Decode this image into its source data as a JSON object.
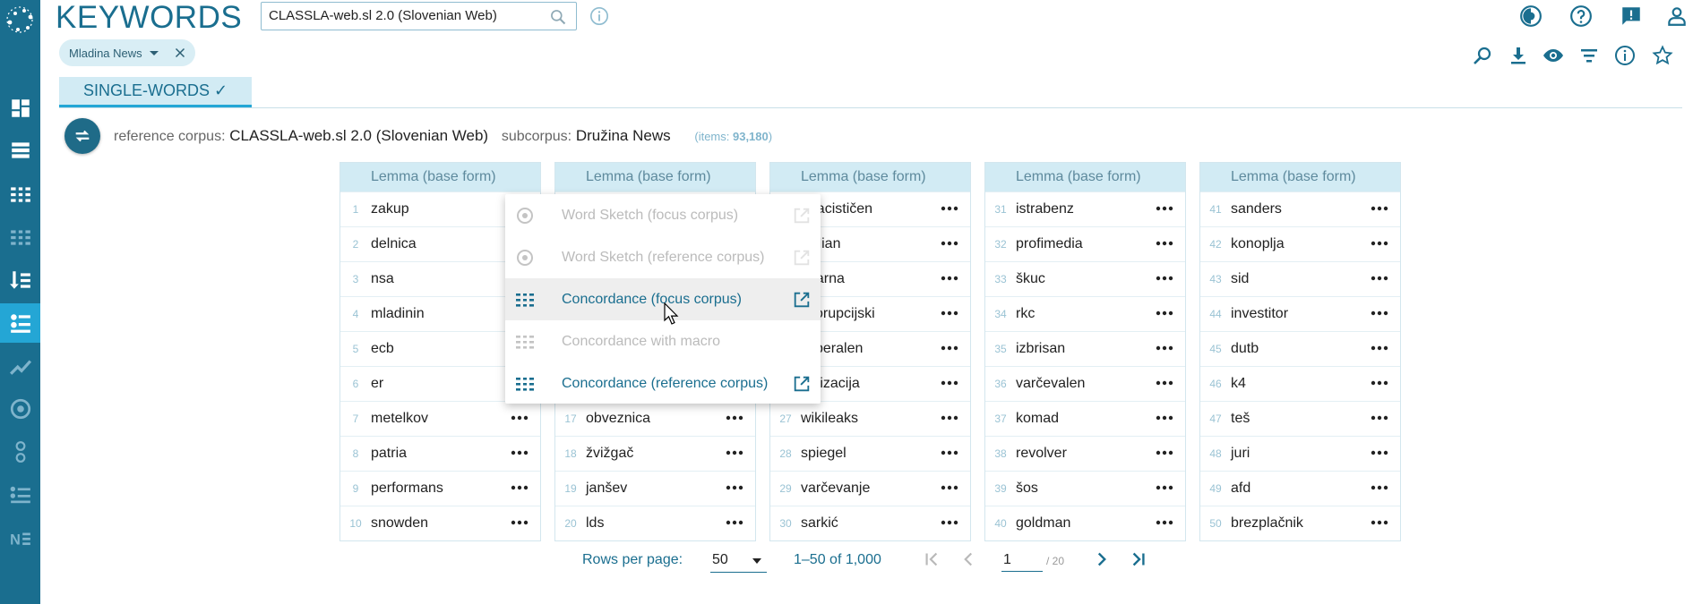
{
  "app": {
    "title": "KEYWORDS"
  },
  "search": {
    "value": "CLASSLA-web.sl 2.0 (Slovenian Web)"
  },
  "filter_chip": {
    "label": "Mladina News"
  },
  "tab": {
    "label": "SINGLE-WORDS ✓"
  },
  "corpus_info": {
    "ref_label": "reference corpus:",
    "ref_value": "CLASSLA-web.sl 2.0 (Slovenian Web)",
    "sub_label": "subcorpus:",
    "sub_value": "Družina News",
    "items_prefix": "(items: ",
    "items_count": "93,180",
    "items_suffix": ")"
  },
  "table": {
    "header": "Lemma (base form)",
    "columns": [
      [
        {
          "n": "1",
          "w": "zakup"
        },
        {
          "n": "2",
          "w": "delnica"
        },
        {
          "n": "3",
          "w": "nsa"
        },
        {
          "n": "4",
          "w": "mladinin"
        },
        {
          "n": "5",
          "w": "ecb"
        },
        {
          "n": "6",
          "w": "er"
        },
        {
          "n": "7",
          "w": "metelkov"
        },
        {
          "n": "8",
          "w": "patria"
        },
        {
          "n": "9",
          "w": "performans"
        },
        {
          "n": "10",
          "w": "snowden"
        }
      ],
      [
        {
          "n": "",
          "w": ""
        },
        {
          "n": "",
          "w": ""
        },
        {
          "n": "",
          "w": ""
        },
        {
          "n": "",
          "w": ""
        },
        {
          "n": "",
          "w": ""
        },
        {
          "n": "",
          "w": ""
        },
        {
          "n": "17",
          "w": "obveznica"
        },
        {
          "n": "18",
          "w": "žvižgač"
        },
        {
          "n": "19",
          "w": "janšev"
        },
        {
          "n": "20",
          "w": "lds"
        }
      ],
      [
        {
          "n": "",
          "w": "onacističen"
        },
        {
          "n": "",
          "w": "ardian"
        },
        {
          "n": "",
          "w": "ovarna"
        },
        {
          "n": "",
          "w": "tikorupcijski"
        },
        {
          "n": "",
          "w": "oliberalen"
        },
        {
          "n": "",
          "w": "vatizacija"
        },
        {
          "n": "27",
          "w": "wikileaks"
        },
        {
          "n": "28",
          "w": "spiegel"
        },
        {
          "n": "29",
          "w": "varčevanje"
        },
        {
          "n": "30",
          "w": "sarkić"
        }
      ],
      [
        {
          "n": "31",
          "w": "istrabenz"
        },
        {
          "n": "32",
          "w": "profimedia"
        },
        {
          "n": "33",
          "w": "škuc"
        },
        {
          "n": "34",
          "w": "rkc"
        },
        {
          "n": "35",
          "w": "izbrisan"
        },
        {
          "n": "36",
          "w": "varčevalen"
        },
        {
          "n": "37",
          "w": "komad"
        },
        {
          "n": "38",
          "w": "revolver"
        },
        {
          "n": "39",
          "w": "šos"
        },
        {
          "n": "40",
          "w": "goldman"
        }
      ],
      [
        {
          "n": "41",
          "w": "sanders"
        },
        {
          "n": "42",
          "w": "konoplja"
        },
        {
          "n": "43",
          "w": "sid"
        },
        {
          "n": "44",
          "w": "investitor"
        },
        {
          "n": "45",
          "w": "dutb"
        },
        {
          "n": "46",
          "w": "k4"
        },
        {
          "n": "47",
          "w": "teš"
        },
        {
          "n": "48",
          "w": "juri"
        },
        {
          "n": "49",
          "w": "afd"
        },
        {
          "n": "50",
          "w": "brezplačnik"
        }
      ]
    ]
  },
  "context_menu": {
    "items": [
      {
        "label": "Word Sketch (focus corpus)",
        "enabled": false,
        "icon": "word-sketch-icon"
      },
      {
        "label": "Word Sketch (reference corpus)",
        "enabled": false,
        "icon": "word-sketch-icon"
      },
      {
        "label": "Concordance (focus corpus)",
        "enabled": true,
        "icon": "concordance-icon"
      },
      {
        "label": "Concordance with macro",
        "enabled": false,
        "icon": "concordance-icon"
      },
      {
        "label": "Concordance (reference corpus)",
        "enabled": true,
        "icon": "concordance-icon"
      }
    ]
  },
  "pagination": {
    "rows_label": "Rows per page:",
    "rows_value": "50",
    "range": "1–50 of 1,000",
    "page": "1",
    "total": "/ 20"
  },
  "colors": {
    "accent": "#1a6e8f",
    "rail": "#1a6e8f",
    "active": "#24a6d5",
    "header_bg": "#d2ebf4"
  }
}
